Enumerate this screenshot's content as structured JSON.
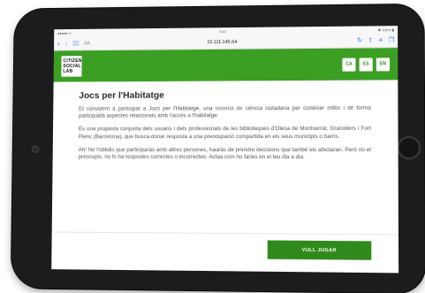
{
  "status_bar": {
    "carrier": "●●●●● ᯤ",
    "time": "9:41",
    "battery": "✱ 100% ▮"
  },
  "browser": {
    "url": "10.111.145.64",
    "aa": "AA"
  },
  "site": {
    "logo_lines": [
      "CITIZEN",
      "SOCIAL",
      "LAB"
    ],
    "languages": [
      "CA",
      "ES",
      "EN"
    ]
  },
  "page": {
    "title": "Jocs per l'Habitatge",
    "paragraphs": [
      "Et convidem a participar a Jocs per l'Habitatge, una recerca de ciència ciutadana per conèixer millor i de forma participada aspectes relacionats amb l'accés a l'habitatge.",
      "És una proposta conjunta dels usuaris i dels professionals de les biblioteques d'Olesa de Montserrat, Granollers i Fort Pienc (Barcelona), que busca donar resposta a una preocupació compartida en els seus municipis o barris.",
      "Ah! No t'oblidis que participaràs amb altres persones, hauràs de prendre decisions que també els afectaran. Però no et preocupis, no hi ha respostes correctes o incorrectes. Actua com ho faries en el teu dia a dia."
    ],
    "cta_label": "VULL JUGAR"
  },
  "colors": {
    "brand_green": "#3a9f22",
    "button_green": "#2f8a1b"
  }
}
